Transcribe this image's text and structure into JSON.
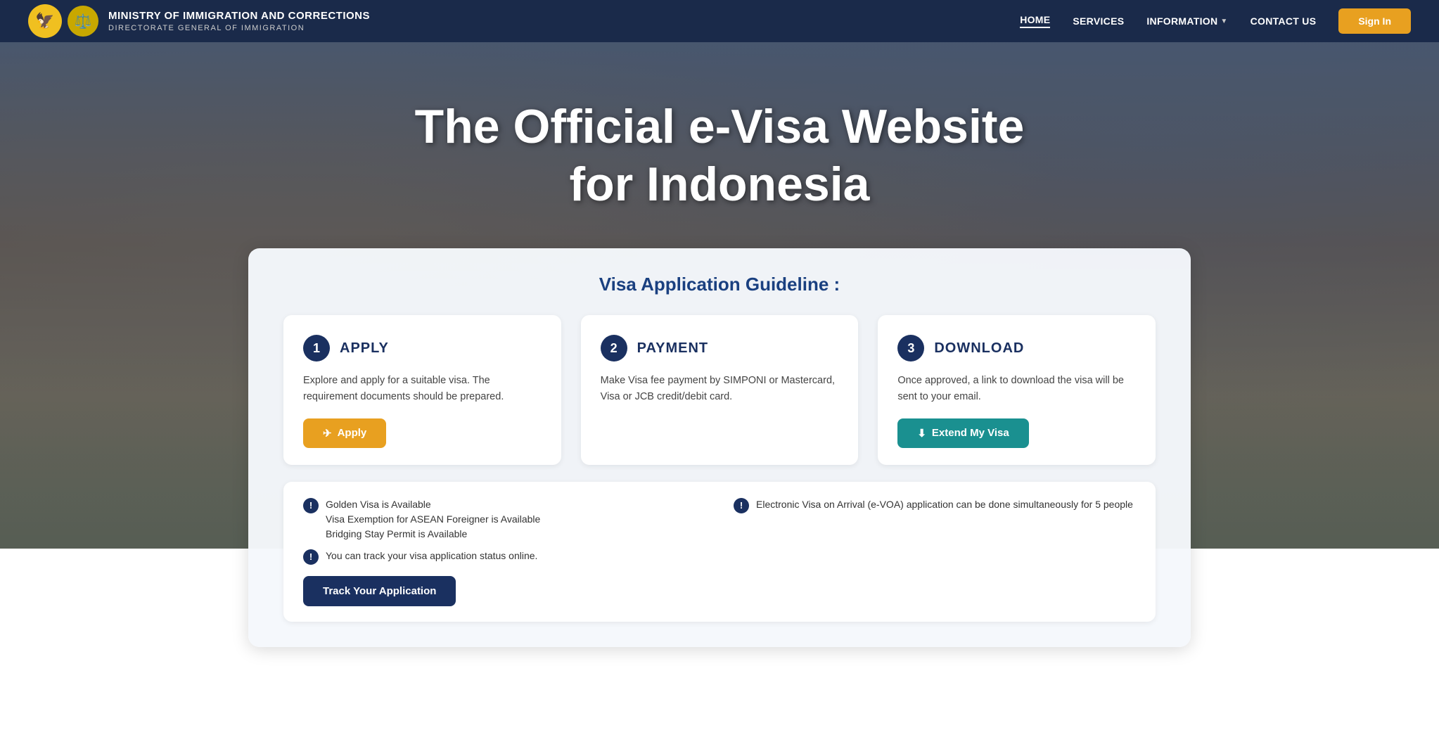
{
  "header": {
    "org_line1": "MINISTRY OF IMMIGRATION AND CORRECTIONS",
    "org_line2": "DIRECTORATE GENERAL OF IMMIGRATION",
    "nav": {
      "home": "HOME",
      "services": "SERVICES",
      "information": "INFORMATION",
      "contact": "CONTACT US",
      "signin": "Sign In"
    }
  },
  "hero": {
    "title_line1": "The Official e-Visa Website",
    "title_line2": "for Indonesia"
  },
  "guideline": {
    "title": "Visa Application Guideline :",
    "steps": [
      {
        "number": "1",
        "label": "APPLY",
        "description": "Explore and apply for a suitable visa. The requirement documents should be prepared.",
        "button": "Apply"
      },
      {
        "number": "2",
        "label": "PAYMENT",
        "description": "Make Visa fee payment by SIMPONI or Mastercard, Visa or JCB credit/debit card.",
        "button": null
      },
      {
        "number": "3",
        "label": "DOWNLOAD",
        "description": "Once approved, a link to download the visa will be sent to your email.",
        "button": "Extend My Visa"
      }
    ],
    "info": {
      "left_items": [
        "Golden Visa is Available",
        "Visa Exemption for ASEAN Foreigner is Available",
        "Bridging Stay Permit is Available",
        "You can track your visa application status online."
      ],
      "right_items": [
        "Electronic Visa on Arrival (e-VOA) application can be done simultaneously for 5 people"
      ],
      "track_button": "Track Your Application"
    }
  }
}
